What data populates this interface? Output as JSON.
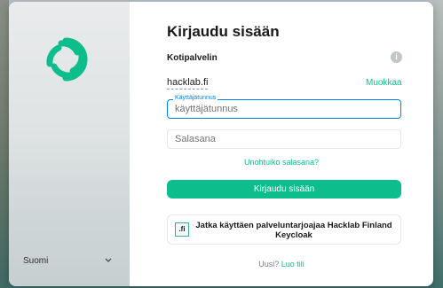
{
  "brand": {
    "accent": "#0dbd8b",
    "focus": "#0086e6"
  },
  "sidebar": {
    "language": "Suomi"
  },
  "login": {
    "title": "Kirjaudu sisään",
    "homeserver_label": "Kotipalvelin",
    "homeserver_value": "hacklab.fi",
    "edit_link": "Muokkaa",
    "username": {
      "floating_label": "Käyttäjätunnus",
      "placeholder": "käyttäjätunnus",
      "value": ""
    },
    "password": {
      "placeholder": "Salasana",
      "value": ""
    },
    "forgot_link": "Unohtuiko salasana?",
    "signin_button": "Kirjaudu sisään",
    "sso": {
      "icon_text": ".fi",
      "label": "Jatka käyttäen palveluntarjoajaa Hacklab Finland Keycloak"
    },
    "new_prompt": "Uusi?",
    "create_account": "Luo tili"
  }
}
